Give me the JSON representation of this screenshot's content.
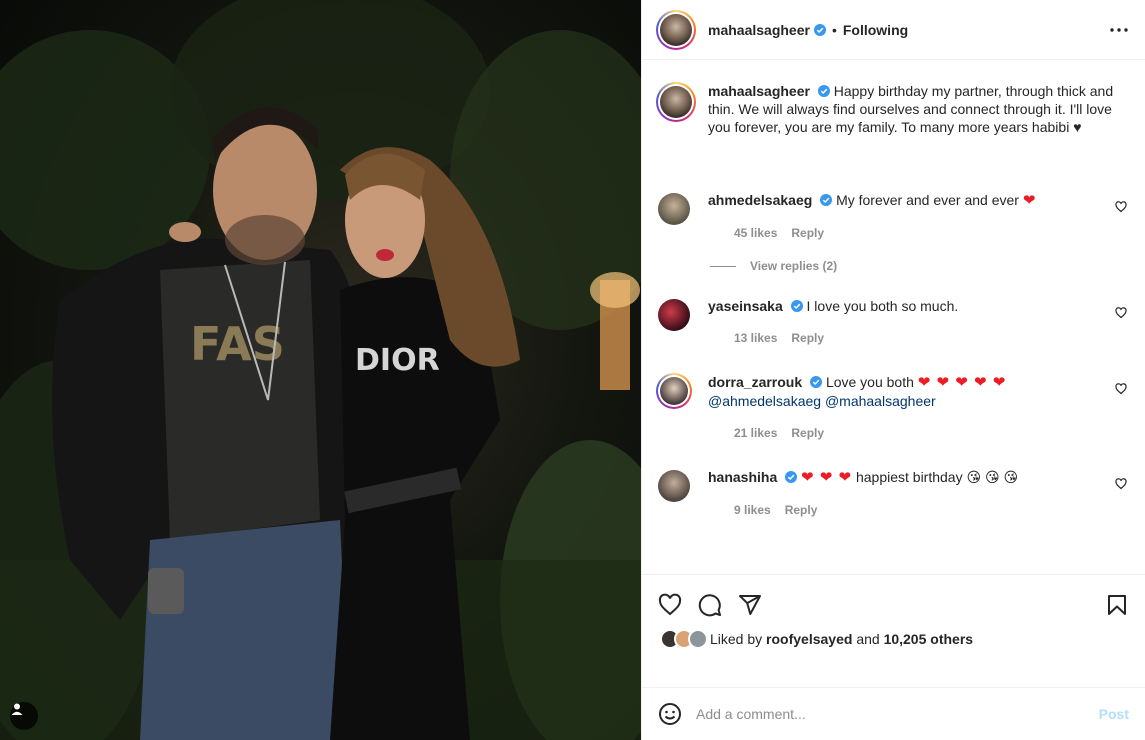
{
  "post": {
    "author": "mahaalsagheer",
    "follow_status": "Following",
    "separator": "•",
    "caption": "Happy birthday my partner, through thick and thin. We will always find ourselves and connect through it. I'll love you forever, you are my family. To many more years habibi ♥"
  },
  "comments": [
    {
      "user": "ahmedelsakaeg",
      "text": "My forever and ever and ever",
      "emoji": "❤",
      "likes": "45 likes",
      "reply": "Reply",
      "avatar_color": "#5a5445"
    },
    {
      "user": "yaseinsaka",
      "text": "I love you both so much.",
      "emoji": "",
      "likes": "13 likes",
      "reply": "Reply",
      "avatar_color": "#7a1d2a"
    },
    {
      "user": "dorra_zarrouk",
      "text": "Love you both",
      "emoji": "❤ ❤ ❤ ❤ ❤",
      "mention1": "@ahmedelsakaeg",
      "mention2": "@mahaalsagheer",
      "likes": "21 likes",
      "reply": "Reply",
      "avatar_color": "#3b3030"
    },
    {
      "user": "hanashiha",
      "pre_emoji": "❤ ❤ ❤",
      "text": "happiest birthday",
      "emoji": "😘 😘 😘",
      "likes": "9 likes",
      "reply": "Reply",
      "avatar_color": "#4e4640"
    }
  ],
  "view_replies": "View replies (2)",
  "liked_by": {
    "prefix": "Liked by",
    "user": "roofyelsayed",
    "conj": "and",
    "others": "10,205 others"
  },
  "add_comment": {
    "placeholder": "Add a comment...",
    "post_label": "Post"
  },
  "icons": {
    "verified": "verified-badge-icon",
    "more": "more-options-icon",
    "like": "heart-icon",
    "comment": "comment-icon",
    "share": "share-icon",
    "save": "bookmark-icon",
    "emoji": "emoji-icon",
    "tag": "user-tag-icon"
  },
  "colors": {
    "verified_blue": "#3897f0",
    "link": "#00376b",
    "post_disabled": "#b2dffc"
  }
}
